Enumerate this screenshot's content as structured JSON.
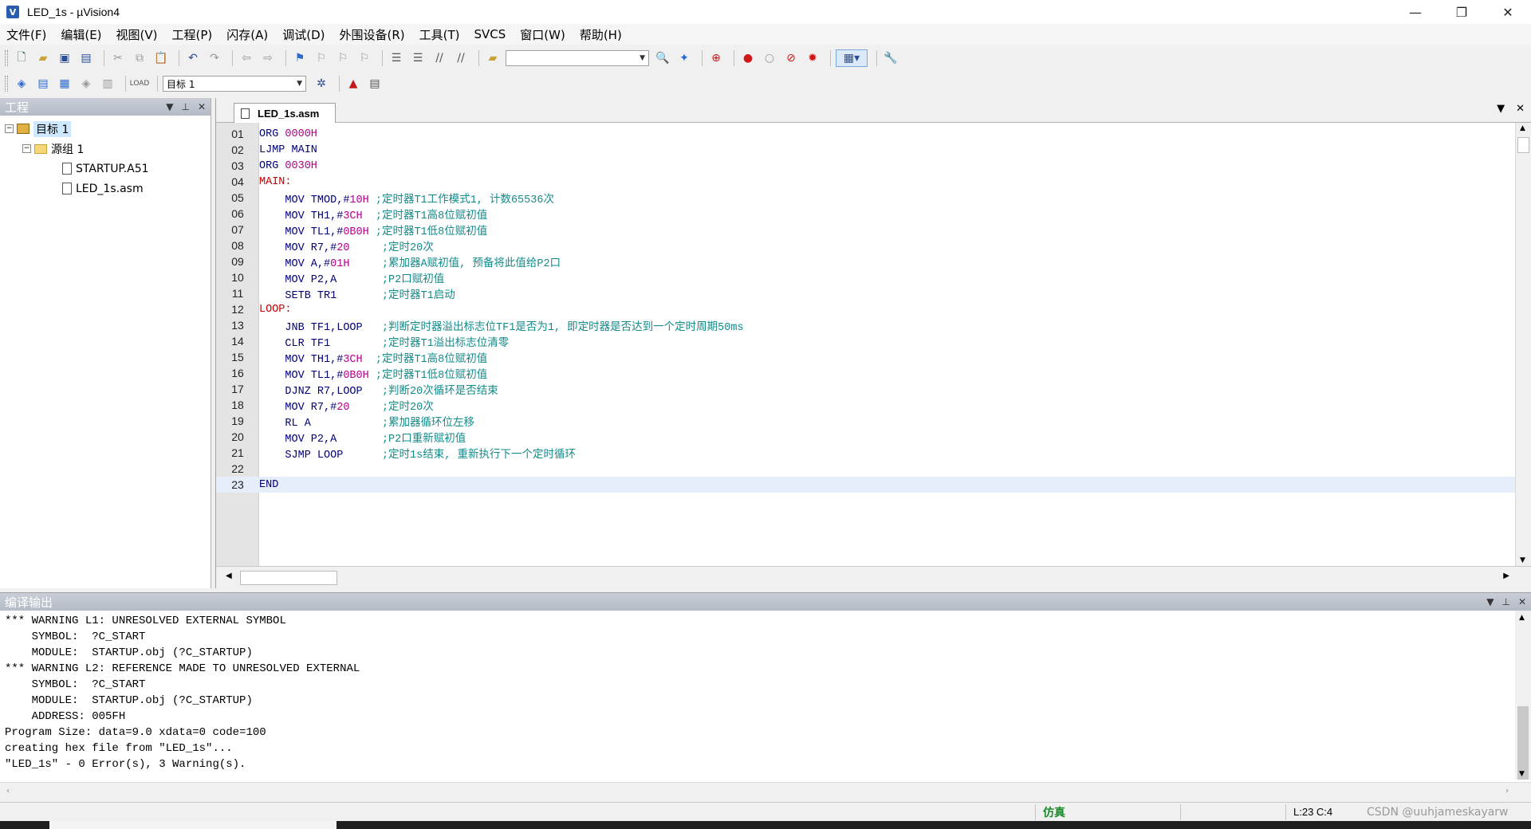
{
  "window": {
    "title": "LED_1s  - µVision4",
    "icon_letter": "V",
    "minimize": "—",
    "restore": "❐",
    "close": "✕"
  },
  "menu": [
    "文件(F)",
    "编辑(E)",
    "视图(V)",
    "工程(P)",
    "闪存(A)",
    "调试(D)",
    "外围设备(R)",
    "工具(T)",
    "SVCS",
    "窗口(W)",
    "帮助(H)"
  ],
  "toolbar": {
    "target_combo_value": "目标 1",
    "find_combo_value": ""
  },
  "project_panel": {
    "title": "工程",
    "tree": {
      "target": "目标 1",
      "group": "源组 1",
      "files": [
        "STARTUP.A51",
        "LED_1s.asm"
      ]
    }
  },
  "editor": {
    "tab_label": "LED_1s.asm",
    "lines": [
      {
        "n": "01",
        "kw": "ORG ",
        "num": "0000H",
        "rest": "",
        "cm": ""
      },
      {
        "n": "02",
        "kw": "LJMP MAIN",
        "num": "",
        "rest": "",
        "cm": ""
      },
      {
        "n": "03",
        "kw": "ORG ",
        "num": "0030H",
        "rest": "",
        "cm": ""
      },
      {
        "n": "04",
        "label": "MAIN:"
      },
      {
        "n": "05",
        "kw": "    MOV TMOD,#",
        "num": "10H",
        "rest": " ",
        "cm": ";定时器T1工作模式1, 计数65536次"
      },
      {
        "n": "06",
        "kw": "    MOV TH1,#",
        "num": "3CH",
        "rest": "  ",
        "cm": ";定时器T1高8位赋初值"
      },
      {
        "n": "07",
        "kw": "    MOV TL1,#",
        "num": "0B0H",
        "rest": " ",
        "cm": ";定时器T1低8位赋初值"
      },
      {
        "n": "08",
        "kw": "    MOV R7,#",
        "num": "20",
        "rest": "     ",
        "cm": ";定时20次"
      },
      {
        "n": "09",
        "kw": "    MOV A,#",
        "num": "01H",
        "rest": "     ",
        "cm": ";累加器A赋初值, 预备将此值给P2口"
      },
      {
        "n": "10",
        "kw": "    MOV P2,A",
        "num": "",
        "rest": "       ",
        "cm": ";P2口赋初值"
      },
      {
        "n": "11",
        "kw": "    SETB TR1",
        "num": "",
        "rest": "       ",
        "cm": ";定时器T1启动"
      },
      {
        "n": "12",
        "label": "LOOP:"
      },
      {
        "n": "13",
        "kw": "    JNB TF1,LOOP",
        "num": "",
        "rest": "   ",
        "cm": ";判断定时器溢出标志位TF1是否为1, 即定时器是否达到一个定时周期50ms"
      },
      {
        "n": "14",
        "kw": "    CLR TF1",
        "num": "",
        "rest": "        ",
        "cm": ";定时器T1溢出标志位清零"
      },
      {
        "n": "15",
        "kw": "    MOV TH1,#",
        "num": "3CH",
        "rest": "  ",
        "cm": ";定时器T1高8位赋初值"
      },
      {
        "n": "16",
        "kw": "    MOV TL1,#",
        "num": "0B0H",
        "rest": " ",
        "cm": ";定时器T1低8位赋初值"
      },
      {
        "n": "17",
        "kw": "    DJNZ R7,LOOP",
        "num": "",
        "rest": "   ",
        "cm": ";判断20次循环是否结束"
      },
      {
        "n": "18",
        "kw": "    MOV R7,#",
        "num": "20",
        "rest": "     ",
        "cm": ";定时20次"
      },
      {
        "n": "19",
        "kw": "    RL A",
        "num": "",
        "rest": "           ",
        "cm": ";累加器循环位左移"
      },
      {
        "n": "20",
        "kw": "    MOV P2,A",
        "num": "",
        "rest": "       ",
        "cm": ";P2口重新赋初值"
      },
      {
        "n": "21",
        "kw": "    SJMP LOOP",
        "num": "",
        "rest": "      ",
        "cm": ";定时1s结束, 重新执行下一个定时循环"
      },
      {
        "n": "22",
        "kw": "",
        "num": "",
        "rest": "",
        "cm": ""
      },
      {
        "n": "23",
        "kw": "END",
        "num": "",
        "rest": "",
        "cm": "",
        "active": true
      }
    ]
  },
  "build_output": {
    "title": "编译输出",
    "lines": [
      "*** WARNING L1: UNRESOLVED EXTERNAL SYMBOL",
      "    SYMBOL:  ?C_START",
      "    MODULE:  STARTUP.obj (?C_STARTUP)",
      "*** WARNING L2: REFERENCE MADE TO UNRESOLVED EXTERNAL",
      "    SYMBOL:  ?C_START",
      "    MODULE:  STARTUP.obj (?C_STARTUP)",
      "    ADDRESS: 005FH",
      "Program Size: data=9.0 xdata=0 code=100",
      "creating hex file from \"LED_1s\"...",
      "\"LED_1s\" - 0 Error(s), 3 Warning(s)."
    ]
  },
  "status": {
    "mode": "仿真",
    "position": "L:23 C:4",
    "watermark": "CSDN @uuhjameskayarw"
  }
}
